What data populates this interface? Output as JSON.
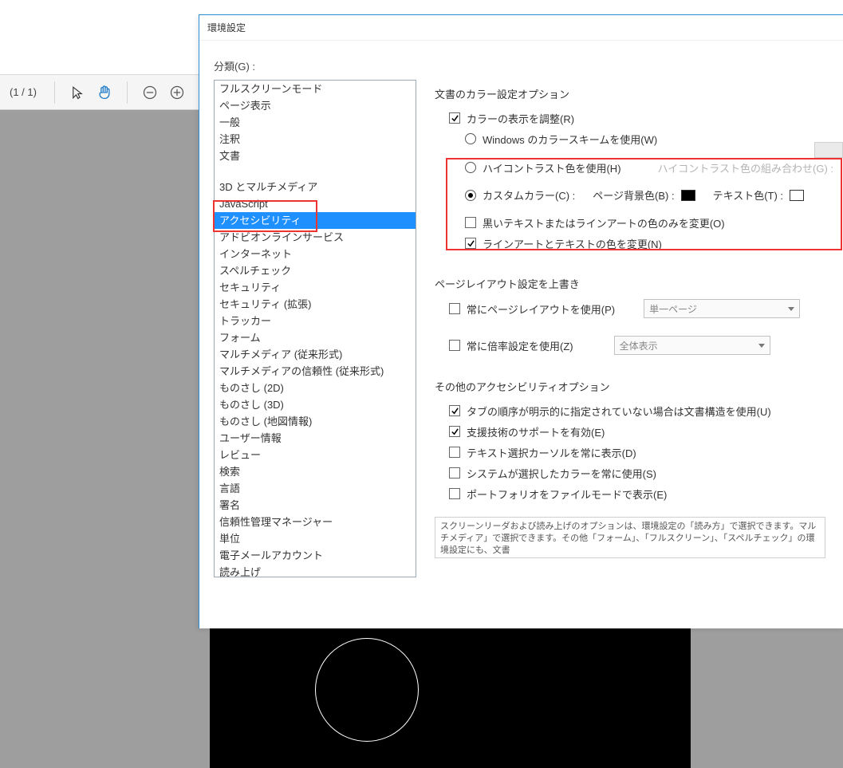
{
  "viewer": {
    "page_counter": "(1 / 1)"
  },
  "dialog": {
    "title": "環境設定",
    "categories_label": "分類(G) :",
    "categories_group1": [
      "フルスクリーンモード",
      "ページ表示",
      "一般",
      "注釈",
      "文書"
    ],
    "categories_group2": [
      "3D とマルチメディア",
      "JavaScript",
      "アクセシビリティ",
      "アドビオンラインサービス",
      "インターネット",
      "スペルチェック",
      "セキュリティ",
      "セキュリティ (拡張)",
      "トラッカー",
      "フォーム",
      "マルチメディア (従来形式)",
      "マルチメディアの信頼性 (従来形式)",
      "ものさし (2D)",
      "ものさし (3D)",
      "ものさし (地図情報)",
      "ユーザー情報",
      "レビュー",
      "検索",
      "言語",
      "署名",
      "信頼性管理マネージャー",
      "単位",
      "電子メールアカウント",
      "読み上げ"
    ],
    "selected_category": "アクセシビリティ",
    "color_group": {
      "title": "文書のカラー設定オプション",
      "adjust": "カラーの表示を調整(R)",
      "windows_scheme": "Windows のカラースキームを使用(W)",
      "high_contrast": "ハイコントラスト色を使用(H)",
      "hc_combo_label": "ハイコントラスト色の組み合わせ(G) :",
      "custom_color": "カスタムカラー(C) :",
      "page_bg": "ページ背景色(B) :",
      "text_color": "テキスト色(T) :",
      "only_text_lineart": "黒いテキストまたはラインアートの色のみを変更(O)",
      "change_lineart_text": "ラインアートとテキストの色を変更(N)"
    },
    "layout_group": {
      "title": "ページレイアウト設定を上書き",
      "always_layout": "常にページレイアウトを使用(P)",
      "layout_sel": "単一ページ",
      "always_zoom": "常に倍率設定を使用(Z)",
      "zoom_sel": "全体表示"
    },
    "other_group": {
      "title": "その他のアクセシビリティオプション",
      "tab_order": "タブの順序が明示的に指定されていない場合は文書構造を使用(U)",
      "assist_tech": "支援技術のサポートを有効(E)",
      "text_cursor": "テキスト選択カーソルを常に表示(D)",
      "sys_color": "システムが選択したカラーを常に使用(S)",
      "portfolio": "ポートフォリオをファイルモードで表示(E)",
      "hint": "スクリーンリーダおよび読み上げのオプションは、環境設定の「読み方」で選択できます。マルチメディア」で選択できます。その他「フォーム」、「フルスクリーン」、「スペルチェック」の環境設定にも、文書"
    }
  }
}
